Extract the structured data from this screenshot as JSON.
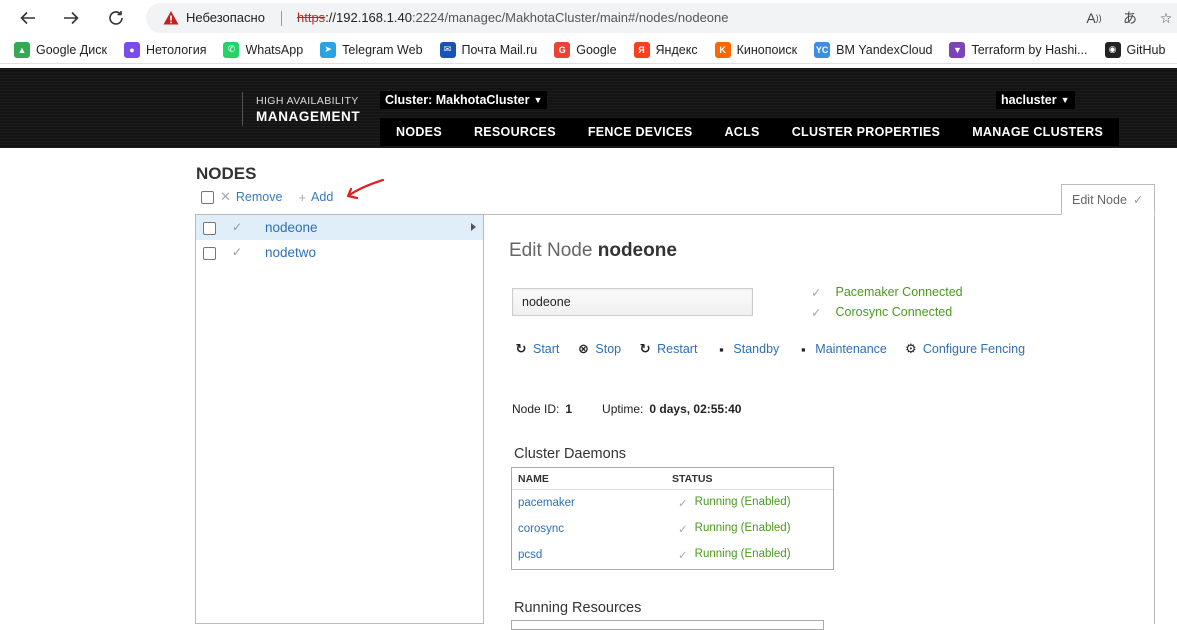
{
  "browser": {
    "insecure_label": "Небезопасно",
    "url_scheme": "https",
    "url_host": "://192.168.1.40",
    "url_rest": ":2224/managec/MakhotaCluster/main#/nodes/nodeone",
    "bookmarks": [
      {
        "label": "Google Диск",
        "icon": "google-drive-icon",
        "color": "#34a853"
      },
      {
        "label": "Нетология",
        "icon": "netology-icon",
        "color": "#7a4cf0"
      },
      {
        "label": "WhatsApp",
        "icon": "whatsapp-icon",
        "color": "#25d366"
      },
      {
        "label": "Telegram Web",
        "icon": "telegram-icon",
        "color": "#2aa3e0"
      },
      {
        "label": "Почта Mail.ru",
        "icon": "mail-icon",
        "color": "#1a53b5"
      },
      {
        "label": "Google",
        "icon": "google-icon",
        "color": "#ea4335"
      },
      {
        "label": "Яндекс",
        "icon": "yandex-icon",
        "color": "#fc3f1d"
      },
      {
        "label": "Кинопоиск",
        "icon": "kinopoisk-icon",
        "color": "#ff6600"
      },
      {
        "label": "ВМ YandexCloud",
        "icon": "yandexcloud-icon",
        "color": "#3a8fe0"
      },
      {
        "label": "Terraform by Hashi...",
        "icon": "terraform-icon",
        "color": "#7b42bc"
      },
      {
        "label": "GitHub",
        "icon": "github-icon",
        "color": "#222222"
      }
    ]
  },
  "header": {
    "brand_top": "HIGH AVAILABILITY",
    "brand_bottom": "MANAGEMENT",
    "cluster_label": "Cluster: MakhotaCluster",
    "user_label": "hacluster",
    "tabs": [
      "NODES",
      "RESOURCES",
      "FENCE DEVICES",
      "ACLS",
      "CLUSTER PROPERTIES",
      "MANAGE CLUSTERS"
    ]
  },
  "page": {
    "title": "NODES",
    "remove_label": "Remove",
    "add_label": "Add",
    "edit_tab_label": "Edit Node"
  },
  "nodes": [
    "nodeone",
    "nodetwo"
  ],
  "detail": {
    "title_prefix": "Edit Node",
    "title_node": "nodeone",
    "input_value": "nodeone",
    "status": [
      "Pacemaker Connected",
      "Corosync Connected"
    ],
    "actions": [
      "Start",
      "Stop",
      "Restart",
      "Standby",
      "Maintenance",
      "Configure Fencing"
    ],
    "node_id_label": "Node ID:",
    "node_id_value": "1",
    "uptime_label": "Uptime:",
    "uptime_value": "0 days, 02:55:40",
    "daemons_title": "Cluster Daemons",
    "daemons_headers": [
      "NAME",
      "STATUS"
    ],
    "daemons": [
      {
        "name": "pacemaker",
        "status": "Running (Enabled)"
      },
      {
        "name": "corosync",
        "status": "Running (Enabled)"
      },
      {
        "name": "pcsd",
        "status": "Running (Enabled)"
      }
    ],
    "resources_title": "Running Resources"
  },
  "colors": {
    "accent_link": "#2d6fb8",
    "status_ok": "#4a9a1e",
    "header_bg": "#141414",
    "annotation": "#e02020"
  }
}
